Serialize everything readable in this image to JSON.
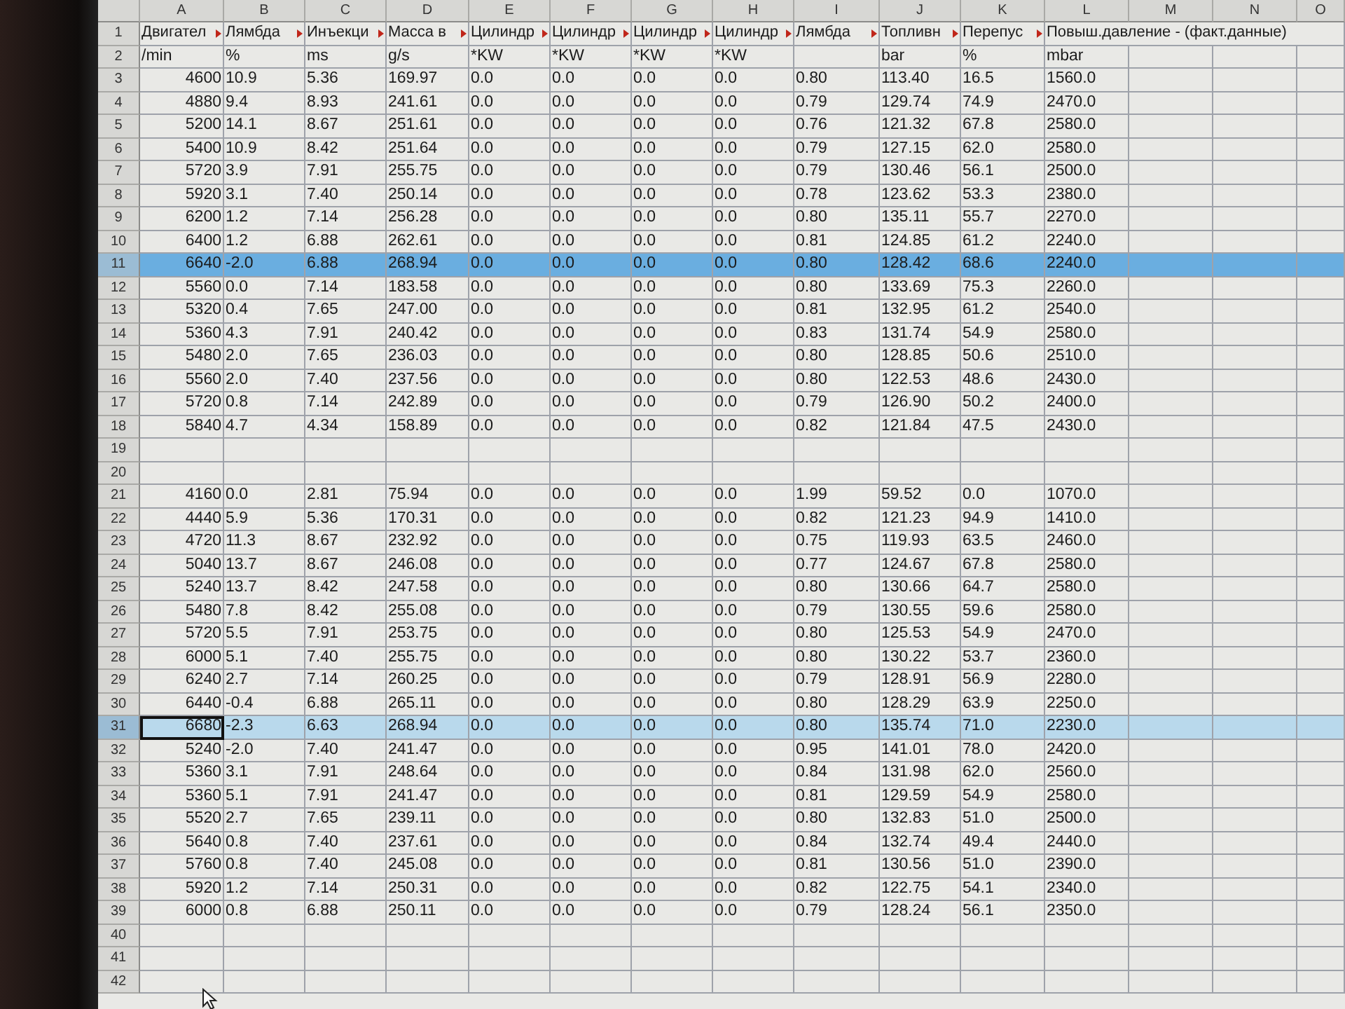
{
  "columns": [
    "A",
    "B",
    "C",
    "D",
    "E",
    "F",
    "G",
    "H",
    "I",
    "J",
    "K",
    "L",
    "M",
    "N",
    "O"
  ],
  "rows": [
    {
      "number": "1",
      "overflow_marks": true,
      "selected": false,
      "active_cell": false,
      "cells": [
        "Двигател",
        "Лямбда",
        "Инъекци",
        "Масса в",
        "Цилиндр",
        "Цилиндр",
        "Цилиндр",
        "Цилиндр",
        "Лямбда",
        "Топливн",
        "Перепус",
        "Повыш.давление - (факт.данные)"
      ]
    },
    {
      "number": "2",
      "overflow_marks": false,
      "selected": false,
      "active_cell": false,
      "cells": [
        "/min",
        "%",
        "ms",
        "g/s",
        "*KW",
        "*KW",
        "*KW",
        "*KW",
        null,
        "bar",
        "%",
        "mbar"
      ]
    },
    {
      "number": "3",
      "overflow_marks": false,
      "selected": false,
      "active_cell": false,
      "cells": [
        "4600",
        "10.9",
        "5.36",
        "169.97",
        "0.0",
        "0.0",
        "0.0",
        "0.0",
        "0.80",
        "113.40",
        "16.5",
        "1560.0"
      ]
    },
    {
      "number": "4",
      "overflow_marks": false,
      "selected": false,
      "active_cell": false,
      "cells": [
        "4880",
        "9.4",
        "8.93",
        "241.61",
        "0.0",
        "0.0",
        "0.0",
        "0.0",
        "0.79",
        "129.74",
        "74.9",
        "2470.0"
      ]
    },
    {
      "number": "5",
      "overflow_marks": false,
      "selected": false,
      "active_cell": false,
      "cells": [
        "5200",
        "14.1",
        "8.67",
        "251.61",
        "0.0",
        "0.0",
        "0.0",
        "0.0",
        "0.76",
        "121.32",
        "67.8",
        "2580.0"
      ]
    },
    {
      "number": "6",
      "overflow_marks": false,
      "selected": false,
      "active_cell": false,
      "cells": [
        "5400",
        "10.9",
        "8.42",
        "251.64",
        "0.0",
        "0.0",
        "0.0",
        "0.0",
        "0.79",
        "127.15",
        "62.0",
        "2580.0"
      ]
    },
    {
      "number": "7",
      "overflow_marks": false,
      "selected": false,
      "active_cell": false,
      "cells": [
        "5720",
        "3.9",
        "7.91",
        "255.75",
        "0.0",
        "0.0",
        "0.0",
        "0.0",
        "0.79",
        "130.46",
        "56.1",
        "2500.0"
      ]
    },
    {
      "number": "8",
      "overflow_marks": false,
      "selected": false,
      "active_cell": false,
      "cells": [
        "5920",
        "3.1",
        "7.40",
        "250.14",
        "0.0",
        "0.0",
        "0.0",
        "0.0",
        "0.78",
        "123.62",
        "53.3",
        "2380.0"
      ]
    },
    {
      "number": "9",
      "overflow_marks": false,
      "selected": false,
      "active_cell": false,
      "cells": [
        "6200",
        "1.2",
        "7.14",
        "256.28",
        "0.0",
        "0.0",
        "0.0",
        "0.0",
        "0.80",
        "135.11",
        "55.7",
        "2270.0"
      ]
    },
    {
      "number": "10",
      "overflow_marks": false,
      "selected": false,
      "active_cell": false,
      "cells": [
        "6400",
        "1.2",
        "6.88",
        "262.61",
        "0.0",
        "0.0",
        "0.0",
        "0.0",
        "0.81",
        "124.85",
        "61.2",
        "2240.0"
      ]
    },
    {
      "number": "11",
      "overflow_marks": false,
      "selected": true,
      "active_cell": false,
      "cells": [
        "6640",
        "-2.0",
        "6.88",
        "268.94",
        "0.0",
        "0.0",
        "0.0",
        "0.0",
        "0.80",
        "128.42",
        "68.6",
        "2240.0"
      ]
    },
    {
      "number": "12",
      "overflow_marks": false,
      "selected": false,
      "active_cell": false,
      "cells": [
        "5560",
        "0.0",
        "7.14",
        "183.58",
        "0.0",
        "0.0",
        "0.0",
        "0.0",
        "0.80",
        "133.69",
        "75.3",
        "2260.0"
      ]
    },
    {
      "number": "13",
      "overflow_marks": false,
      "selected": false,
      "active_cell": false,
      "cells": [
        "5320",
        "0.4",
        "7.65",
        "247.00",
        "0.0",
        "0.0",
        "0.0",
        "0.0",
        "0.81",
        "132.95",
        "61.2",
        "2540.0"
      ]
    },
    {
      "number": "14",
      "overflow_marks": false,
      "selected": false,
      "active_cell": false,
      "cells": [
        "5360",
        "4.3",
        "7.91",
        "240.42",
        "0.0",
        "0.0",
        "0.0",
        "0.0",
        "0.83",
        "131.74",
        "54.9",
        "2580.0"
      ]
    },
    {
      "number": "15",
      "overflow_marks": false,
      "selected": false,
      "active_cell": false,
      "cells": [
        "5480",
        "2.0",
        "7.65",
        "236.03",
        "0.0",
        "0.0",
        "0.0",
        "0.0",
        "0.80",
        "128.85",
        "50.6",
        "2510.0"
      ]
    },
    {
      "number": "16",
      "overflow_marks": false,
      "selected": false,
      "active_cell": false,
      "cells": [
        "5560",
        "2.0",
        "7.40",
        "237.56",
        "0.0",
        "0.0",
        "0.0",
        "0.0",
        "0.80",
        "122.53",
        "48.6",
        "2430.0"
      ]
    },
    {
      "number": "17",
      "overflow_marks": false,
      "selected": false,
      "active_cell": false,
      "cells": [
        "5720",
        "0.8",
        "7.14",
        "242.89",
        "0.0",
        "0.0",
        "0.0",
        "0.0",
        "0.79",
        "126.90",
        "50.2",
        "2400.0"
      ]
    },
    {
      "number": "18",
      "overflow_marks": false,
      "selected": false,
      "active_cell": false,
      "cells": [
        "5840",
        "4.7",
        "4.34",
        "158.89",
        "0.0",
        "0.0",
        "0.0",
        "0.0",
        "0.82",
        "121.84",
        "47.5",
        "2430.0"
      ]
    },
    {
      "number": "19",
      "selected": false,
      "active_cell": false
    },
    {
      "number": "20",
      "selected": false,
      "active_cell": false
    },
    {
      "number": "21",
      "overflow_marks": false,
      "selected": false,
      "active_cell": false,
      "cells": [
        "4160",
        "0.0",
        "2.81",
        "75.94",
        "0.0",
        "0.0",
        "0.0",
        "0.0",
        "1.99",
        "59.52",
        "0.0",
        "1070.0"
      ]
    },
    {
      "number": "22",
      "overflow_marks": false,
      "selected": false,
      "active_cell": false,
      "cells": [
        "4440",
        "5.9",
        "5.36",
        "170.31",
        "0.0",
        "0.0",
        "0.0",
        "0.0",
        "0.82",
        "121.23",
        "94.9",
        "1410.0"
      ]
    },
    {
      "number": "23",
      "overflow_marks": false,
      "selected": false,
      "active_cell": false,
      "cells": [
        "4720",
        "11.3",
        "8.67",
        "232.92",
        "0.0",
        "0.0",
        "0.0",
        "0.0",
        "0.75",
        "119.93",
        "63.5",
        "2460.0"
      ]
    },
    {
      "number": "24",
      "overflow_marks": false,
      "selected": false,
      "active_cell": false,
      "cells": [
        "5040",
        "13.7",
        "8.67",
        "246.08",
        "0.0",
        "0.0",
        "0.0",
        "0.0",
        "0.77",
        "124.67",
        "67.8",
        "2580.0"
      ]
    },
    {
      "number": "25",
      "overflow_marks": false,
      "selected": false,
      "active_cell": false,
      "cells": [
        "5240",
        "13.7",
        "8.42",
        "247.58",
        "0.0",
        "0.0",
        "0.0",
        "0.0",
        "0.80",
        "130.66",
        "64.7",
        "2580.0"
      ]
    },
    {
      "number": "26",
      "overflow_marks": false,
      "selected": false,
      "active_cell": false,
      "cells": [
        "5480",
        "7.8",
        "8.42",
        "255.08",
        "0.0",
        "0.0",
        "0.0",
        "0.0",
        "0.79",
        "130.55",
        "59.6",
        "2580.0"
      ]
    },
    {
      "number": "27",
      "overflow_marks": false,
      "selected": false,
      "active_cell": false,
      "cells": [
        "5720",
        "5.5",
        "7.91",
        "253.75",
        "0.0",
        "0.0",
        "0.0",
        "0.0",
        "0.80",
        "125.53",
        "54.9",
        "2470.0"
      ]
    },
    {
      "number": "28",
      "overflow_marks": false,
      "selected": false,
      "active_cell": false,
      "cells": [
        "6000",
        "5.1",
        "7.40",
        "255.75",
        "0.0",
        "0.0",
        "0.0",
        "0.0",
        "0.80",
        "130.22",
        "53.7",
        "2360.0"
      ]
    },
    {
      "number": "29",
      "overflow_marks": false,
      "selected": false,
      "active_cell": false,
      "cells": [
        "6240",
        "2.7",
        "7.14",
        "260.25",
        "0.0",
        "0.0",
        "0.0",
        "0.0",
        "0.79",
        "128.91",
        "56.9",
        "2280.0"
      ]
    },
    {
      "number": "30",
      "overflow_marks": false,
      "selected": false,
      "active_cell": false,
      "cells": [
        "6440",
        "-0.4",
        "6.88",
        "265.11",
        "0.0",
        "0.0",
        "0.0",
        "0.0",
        "0.80",
        "128.29",
        "63.9",
        "2250.0"
      ]
    },
    {
      "number": "31",
      "overflow_marks": false,
      "selected": true,
      "active_cell": true,
      "cells": [
        "6680",
        "-2.3",
        "6.63",
        "268.94",
        "0.0",
        "0.0",
        "0.0",
        "0.0",
        "0.80",
        "135.74",
        "71.0",
        "2230.0"
      ]
    },
    {
      "number": "32",
      "overflow_marks": false,
      "selected": false,
      "active_cell": false,
      "cells": [
        "5240",
        "-2.0",
        "7.40",
        "241.47",
        "0.0",
        "0.0",
        "0.0",
        "0.0",
        "0.95",
        "141.01",
        "78.0",
        "2420.0"
      ]
    },
    {
      "number": "33",
      "overflow_marks": false,
      "selected": false,
      "active_cell": false,
      "cells": [
        "5360",
        "3.1",
        "7.91",
        "248.64",
        "0.0",
        "0.0",
        "0.0",
        "0.0",
        "0.84",
        "131.98",
        "62.0",
        "2560.0"
      ]
    },
    {
      "number": "34",
      "overflow_marks": false,
      "selected": false,
      "active_cell": false,
      "cells": [
        "5360",
        "5.1",
        "7.91",
        "241.47",
        "0.0",
        "0.0",
        "0.0",
        "0.0",
        "0.81",
        "129.59",
        "54.9",
        "2580.0"
      ]
    },
    {
      "number": "35",
      "overflow_marks": false,
      "selected": false,
      "active_cell": false,
      "cells": [
        "5520",
        "2.7",
        "7.65",
        "239.11",
        "0.0",
        "0.0",
        "0.0",
        "0.0",
        "0.80",
        "132.83",
        "51.0",
        "2500.0"
      ]
    },
    {
      "number": "36",
      "overflow_marks": false,
      "selected": false,
      "active_cell": false,
      "cells": [
        "5640",
        "0.8",
        "7.40",
        "237.61",
        "0.0",
        "0.0",
        "0.0",
        "0.0",
        "0.84",
        "132.74",
        "49.4",
        "2440.0"
      ]
    },
    {
      "number": "37",
      "overflow_marks": false,
      "selected": false,
      "active_cell": false,
      "cells": [
        "5760",
        "0.8",
        "7.40",
        "245.08",
        "0.0",
        "0.0",
        "0.0",
        "0.0",
        "0.81",
        "130.56",
        "51.0",
        "2390.0"
      ]
    },
    {
      "number": "38",
      "overflow_marks": false,
      "selected": false,
      "active_cell": false,
      "cells": [
        "5920",
        "1.2",
        "7.14",
        "250.31",
        "0.0",
        "0.0",
        "0.0",
        "0.0",
        "0.82",
        "122.75",
        "54.1",
        "2340.0"
      ]
    },
    {
      "number": "39",
      "overflow_marks": false,
      "selected": false,
      "active_cell": false,
      "cells": [
        "6000",
        "0.8",
        "6.88",
        "250.11",
        "0.0",
        "0.0",
        "0.0",
        "0.0",
        "0.79",
        "128.24",
        "56.1",
        "2350.0"
      ]
    },
    {
      "number": "40",
      "selected": false,
      "active_cell": false
    },
    {
      "number": "41",
      "selected": false,
      "active_cell": false
    },
    {
      "number": "42",
      "selected": false,
      "active_cell": false
    }
  ]
}
